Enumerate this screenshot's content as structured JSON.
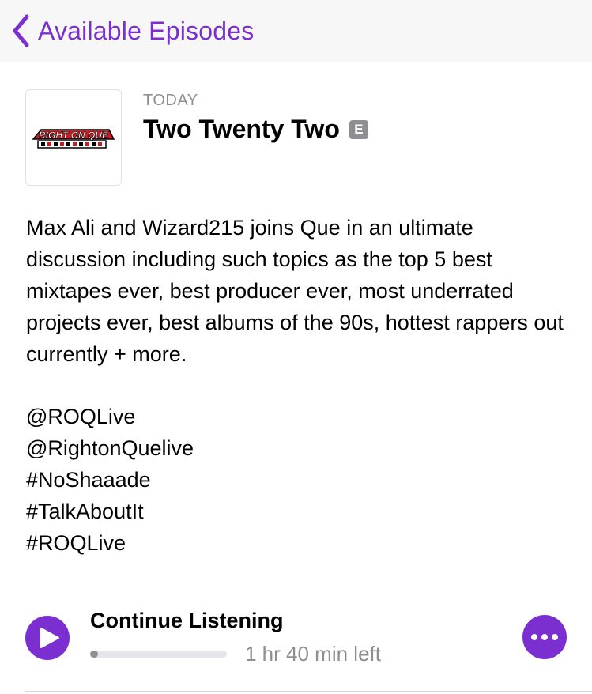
{
  "nav": {
    "back_label": "Available Episodes"
  },
  "episode": {
    "date": "TODAY",
    "title": "Two Twenty Two",
    "explicit_badge": "E",
    "artwork_logo": "RIGHT ON QUE",
    "description": "Max Ali and Wizard215 joins Que in an ultimate discussion including such topics as the top 5 best mixtapes ever, best producer ever, most underrated projects ever, best albums of the 90s, hottest rappers out currently + more.",
    "tags": [
      "@ROQLive",
      "@RightonQuelive",
      "#NoShaaade",
      "#TalkAboutIt",
      "#ROQLive"
    ]
  },
  "player": {
    "continue_label": "Continue Listening",
    "time_left": "1 hr 40 min left",
    "progress_fraction": 0.06
  },
  "colors": {
    "accent": "#7b2fd0",
    "secondary_text": "#8e8e93"
  },
  "icons": {
    "back": "chevron-left-icon",
    "play": "play-icon",
    "more": "ellipsis-icon"
  }
}
